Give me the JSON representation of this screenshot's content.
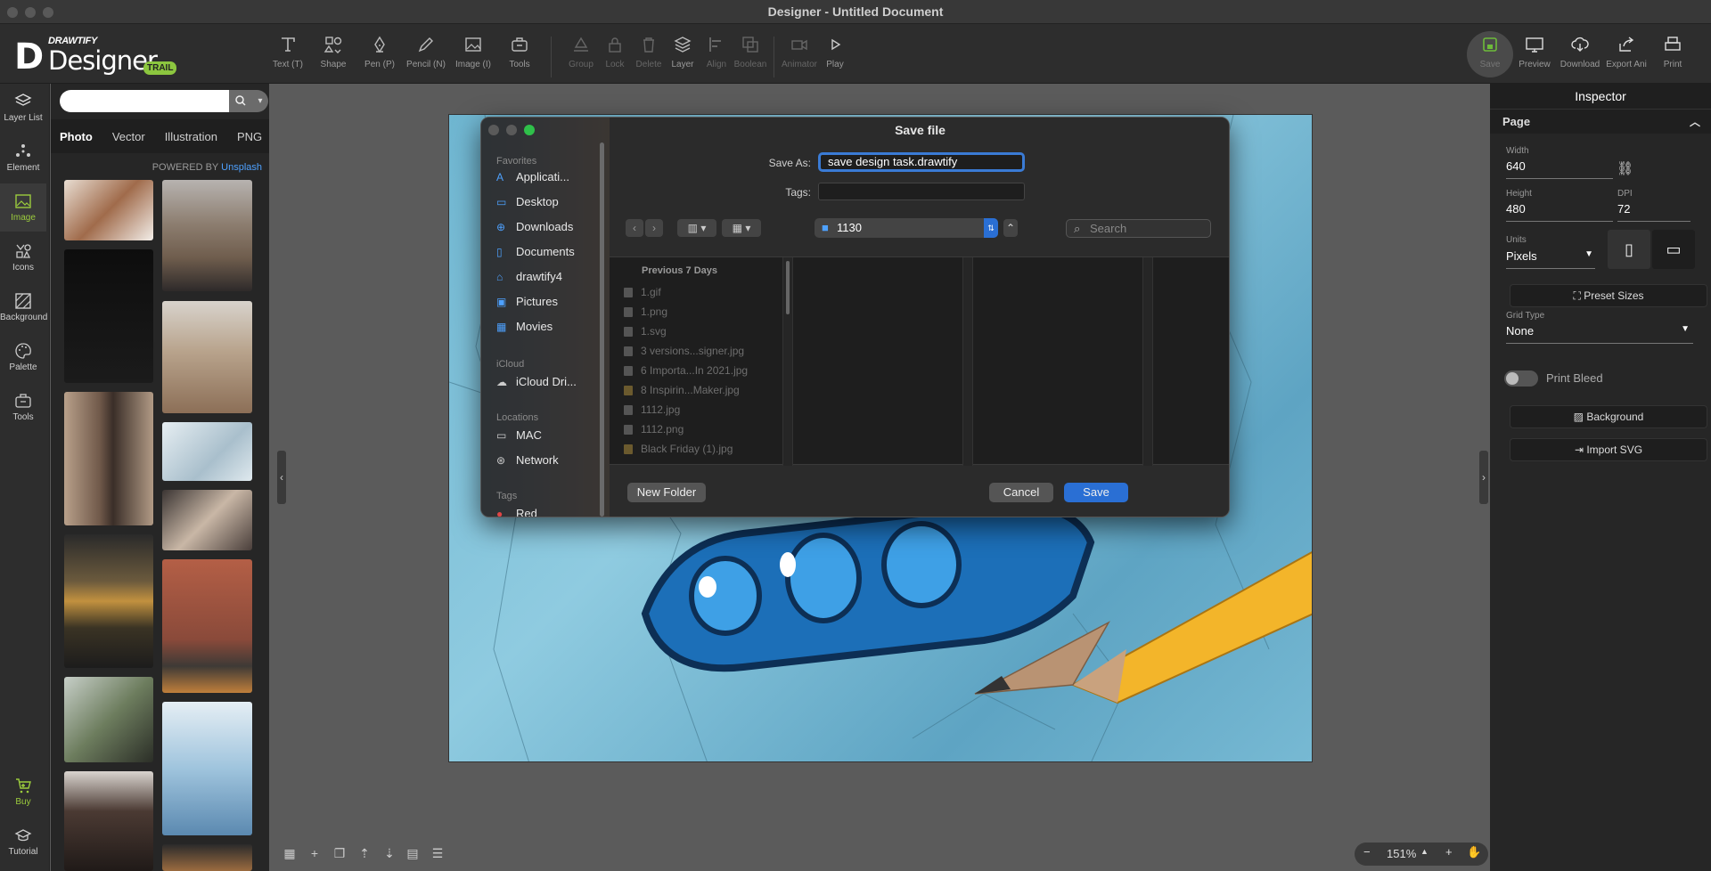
{
  "window": {
    "title": "Designer - Untitled Document"
  },
  "logo": {
    "brand": "DRAWTIFY",
    "product": "Designer",
    "badge": "TRAIL"
  },
  "toolbar": {
    "tools": [
      {
        "label": "Text (T)",
        "icon": "text-icon"
      },
      {
        "label": "Shape",
        "icon": "shape-icon"
      },
      {
        "label": "Pen (P)",
        "icon": "pen-icon"
      },
      {
        "label": "Pencil (N)",
        "icon": "pencil-icon"
      },
      {
        "label": "Image (I)",
        "icon": "image-icon"
      },
      {
        "label": "Tools",
        "icon": "toolbox-icon"
      }
    ],
    "arrange": [
      {
        "label": "Group",
        "icon": "group-icon"
      },
      {
        "label": "Lock",
        "icon": "lock-icon"
      },
      {
        "label": "Delete",
        "icon": "trash-icon"
      },
      {
        "label": "Layer",
        "icon": "layers-icon"
      },
      {
        "label": "Align",
        "icon": "align-icon"
      },
      {
        "label": "Boolean",
        "icon": "boolean-icon"
      }
    ],
    "playback": [
      {
        "label": "Animator",
        "icon": "camera-icon"
      },
      {
        "label": "Play",
        "icon": "play-icon"
      }
    ],
    "right": [
      {
        "label": "Save",
        "icon": "save-icon"
      },
      {
        "label": "Preview",
        "icon": "monitor-icon"
      },
      {
        "label": "Download",
        "icon": "cloud-download-icon"
      },
      {
        "label": "Export Ani",
        "icon": "share-icon"
      },
      {
        "label": "Print",
        "icon": "printer-icon"
      }
    ]
  },
  "leftbar": {
    "items": [
      {
        "label": "Layer List"
      },
      {
        "label": "Element"
      },
      {
        "label": "Image"
      },
      {
        "label": "Icons"
      },
      {
        "label": "Background"
      },
      {
        "label": "Palette"
      },
      {
        "label": "Tools"
      },
      {
        "label": "Buy"
      },
      {
        "label": "Tutorial"
      }
    ]
  },
  "imagePanel": {
    "search_value": "",
    "tabs": [
      "Photo",
      "Vector",
      "Illustration",
      "PNG"
    ],
    "powered_by": "POWERED BY",
    "powered_link": "Unsplash"
  },
  "inspector": {
    "title": "Inspector",
    "section": "Page",
    "width_label": "Width",
    "width_value": "640",
    "height_label": "Height",
    "height_value": "480",
    "dpi_label": "DPI",
    "dpi_value": "72",
    "units_label": "Units",
    "units_value": "Pixels",
    "preset_sizes": "Preset Sizes",
    "grid_type_label": "Grid Type",
    "grid_type_value": "None",
    "print_bleed": "Print Bleed",
    "print_bleed_on": false,
    "background_btn": "Background",
    "import_svg_btn": "Import SVG"
  },
  "zoom": {
    "value": "151%"
  },
  "dialog": {
    "title": "Save file",
    "save_as_label": "Save As:",
    "save_as_value": "save design task.drawtify",
    "tags_label": "Tags:",
    "folder": "1130",
    "search_placeholder": "Search",
    "sidebar": {
      "favorites_label": "Favorites",
      "favorites": [
        "Applicati...",
        "Desktop",
        "Downloads",
        "Documents",
        "drawtify4",
        "Pictures",
        "Movies"
      ],
      "icloud_label": "iCloud",
      "icloud": [
        "iCloud Dri..."
      ],
      "locations_label": "Locations",
      "locations": [
        "MAC",
        "Network"
      ],
      "tags_label": "Tags",
      "tags": [
        "Red"
      ]
    },
    "files_header": "Previous 7 Days",
    "files": [
      "1.gif",
      "1.png",
      "1.svg",
      "3 versions...signer.jpg",
      "6 Importa...In 2021.jpg",
      "8 Inspirin...Maker.jpg",
      "1112.jpg",
      "1112.png",
      "Black Friday (1).jpg"
    ],
    "new_folder": "New Folder",
    "cancel": "Cancel",
    "save": "Save"
  }
}
